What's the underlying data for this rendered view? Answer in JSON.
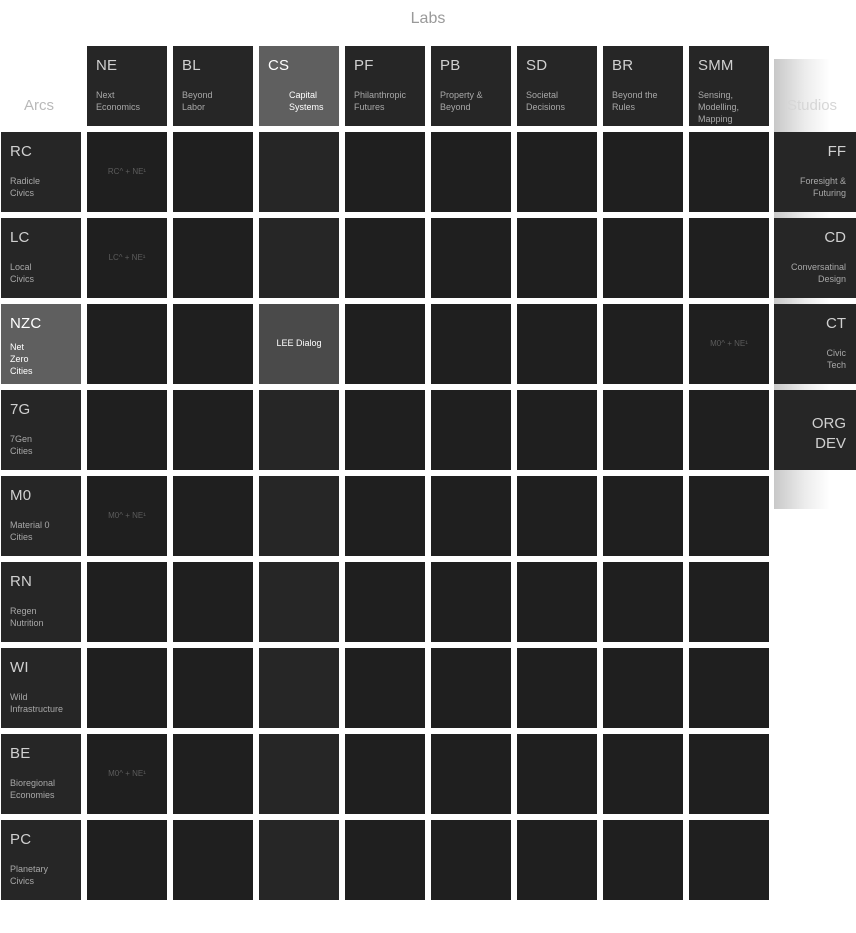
{
  "title": "Labs",
  "arcs_label": "Arcs",
  "studios_label": "Studios",
  "labs": [
    {
      "code": "NE",
      "name": [
        "Next",
        "Economics"
      ],
      "highlight": false
    },
    {
      "code": "BL",
      "name": [
        "Beyond",
        "Labor"
      ],
      "highlight": false
    },
    {
      "code": "CS",
      "name": [
        "Capital",
        "Systems"
      ],
      "highlight": true
    },
    {
      "code": "PF",
      "name": [
        "Philanthropic",
        "Futures"
      ],
      "highlight": false
    },
    {
      "code": "PB",
      "name": [
        "Property &",
        "Beyond"
      ],
      "highlight": false
    },
    {
      "code": "SD",
      "name": [
        "Societal",
        "Decisions"
      ],
      "highlight": false
    },
    {
      "code": "BR",
      "name": [
        "Beyond the",
        "Rules"
      ],
      "highlight": false
    },
    {
      "code": "SMM",
      "name": [
        "Sensing,",
        "Modelling,",
        "Mapping"
      ],
      "highlight": false
    }
  ],
  "arcs": [
    {
      "code": "RC",
      "name": [
        "Radicle",
        "Civics"
      ],
      "highlight": false
    },
    {
      "code": "LC",
      "name": [
        "Local",
        "Civics"
      ],
      "highlight": false
    },
    {
      "code": "NZC",
      "name": [
        "Net",
        "Zero",
        "Cities"
      ],
      "highlight": true
    },
    {
      "code": "7G",
      "name": [
        "7Gen",
        "Cities"
      ],
      "highlight": false
    },
    {
      "code": "M0",
      "name": [
        "Material 0",
        "Cities"
      ],
      "highlight": false
    },
    {
      "code": "RN",
      "name": [
        "Regen",
        "Nutrition"
      ],
      "highlight": false
    },
    {
      "code": "WI",
      "name": [
        "Wild",
        "Infrastructure"
      ],
      "highlight": false
    },
    {
      "code": "BE",
      "name": [
        "Bioregional",
        "Economies"
      ],
      "highlight": false
    },
    {
      "code": "PC",
      "name": [
        "Planetary",
        "Civics"
      ],
      "highlight": false
    }
  ],
  "studios": [
    {
      "code": [
        "FF"
      ],
      "name": [
        "Foresight &",
        "Futuring"
      ]
    },
    {
      "code": [
        "CD"
      ],
      "name": [
        "Conversatinal",
        "Design"
      ]
    },
    {
      "code": [
        "CT"
      ],
      "name": [
        "Civic",
        "Tech"
      ]
    },
    {
      "code": [
        "ORG",
        "DEV"
      ],
      "name": []
    }
  ],
  "cells": [
    {
      "row": 0,
      "col": 0,
      "text": "RC^ + NE¹",
      "highlight": false
    },
    {
      "row": 1,
      "col": 0,
      "text": "LC^ + NE¹",
      "highlight": false
    },
    {
      "row": 2,
      "col": 2,
      "text": "LEE Dialog",
      "highlight": true
    },
    {
      "row": 2,
      "col": 7,
      "text": "M0^ + NE¹",
      "highlight": false
    },
    {
      "row": 4,
      "col": 0,
      "text": "M0^ + NE¹",
      "highlight": false
    },
    {
      "row": 7,
      "col": 0,
      "text": "M0^ + NE¹",
      "highlight": false
    }
  ]
}
